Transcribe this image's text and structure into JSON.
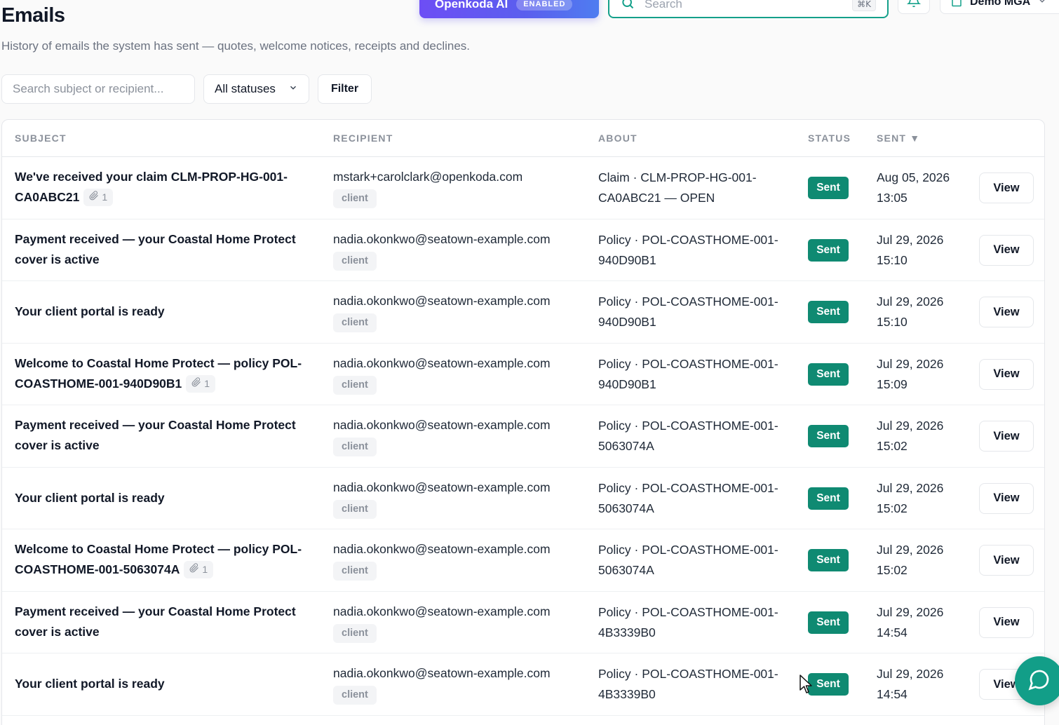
{
  "topbar": {
    "ai_label": "Openkoda AI",
    "ai_badge": "ENABLED",
    "search_placeholder": "Search",
    "search_shortcut": "⌘K",
    "org_name": "Demo MGA"
  },
  "page": {
    "title": "Emails",
    "subtitle": "History of emails the system has sent — quotes, welcome notices, receipts and declines."
  },
  "filters": {
    "search_placeholder": "Search subject or recipient...",
    "status_value": "All statuses",
    "filter_label": "Filter"
  },
  "table": {
    "headers": {
      "subject": "SUBJECT",
      "recipient": "RECIPIENT",
      "about": "ABOUT",
      "status": "STATUS",
      "sent": "SENT ▼"
    },
    "rows": [
      {
        "subject": "We've received your claim CLM-PROP-HG-001-CA0ABC21",
        "attachments": "1",
        "recipient": "mstark+carolclark@openkoda.com",
        "recipient_tag": "client",
        "about": "Claim · CLM-PROP-HG-001-CA0ABC21 — OPEN",
        "status": "Sent",
        "sent": "Aug 05, 2026 13:05",
        "action": "View"
      },
      {
        "subject": "Payment received — your Coastal Home Protect cover is active",
        "attachments": "",
        "recipient": "nadia.okonkwo@seatown-example.com",
        "recipient_tag": "client",
        "about": "Policy · POL-COASTHOME-001-940D90B1",
        "status": "Sent",
        "sent": "Jul 29, 2026 15:10",
        "action": "View"
      },
      {
        "subject": "Your client portal is ready",
        "attachments": "",
        "recipient": "nadia.okonkwo@seatown-example.com",
        "recipient_tag": "client",
        "about": "Policy · POL-COASTHOME-001-940D90B1",
        "status": "Sent",
        "sent": "Jul 29, 2026 15:10",
        "action": "View"
      },
      {
        "subject": "Welcome to Coastal Home Protect — policy POL-COASTHOME-001-940D90B1",
        "attachments": "1",
        "recipient": "nadia.okonkwo@seatown-example.com",
        "recipient_tag": "client",
        "about": "Policy · POL-COASTHOME-001-940D90B1",
        "status": "Sent",
        "sent": "Jul 29, 2026 15:09",
        "action": "View"
      },
      {
        "subject": "Payment received — your Coastal Home Protect cover is active",
        "attachments": "",
        "recipient": "nadia.okonkwo@seatown-example.com",
        "recipient_tag": "client",
        "about": "Policy · POL-COASTHOME-001-5063074A",
        "status": "Sent",
        "sent": "Jul 29, 2026 15:02",
        "action": "View"
      },
      {
        "subject": "Your client portal is ready",
        "attachments": "",
        "recipient": "nadia.okonkwo@seatown-example.com",
        "recipient_tag": "client",
        "about": "Policy · POL-COASTHOME-001-5063074A",
        "status": "Sent",
        "sent": "Jul 29, 2026 15:02",
        "action": "View"
      },
      {
        "subject": "Welcome to Coastal Home Protect — policy POL-COASTHOME-001-5063074A",
        "attachments": "1",
        "recipient": "nadia.okonkwo@seatown-example.com",
        "recipient_tag": "client",
        "about": "Policy · POL-COASTHOME-001-5063074A",
        "status": "Sent",
        "sent": "Jul 29, 2026 15:02",
        "action": "View"
      },
      {
        "subject": "Payment received — your Coastal Home Protect cover is active",
        "attachments": "",
        "recipient": "nadia.okonkwo@seatown-example.com",
        "recipient_tag": "client",
        "about": "Policy · POL-COASTHOME-001-4B3339B0",
        "status": "Sent",
        "sent": "Jul 29, 2026 14:54",
        "action": "View"
      },
      {
        "subject": "Your client portal is ready",
        "attachments": "",
        "recipient": "nadia.okonkwo@seatown-example.com",
        "recipient_tag": "client",
        "about": "Policy · POL-COASTHOME-001-4B3339B0",
        "status": "Sent",
        "sent": "Jul 29, 2026 14:54",
        "action": "View"
      }
    ]
  },
  "icons": {
    "search": "search-icon",
    "bell": "bell-icon",
    "building": "building-icon",
    "chevron": "chevron-down-icon",
    "paperclip": "paperclip-icon",
    "chat": "chat-icon"
  },
  "colors": {
    "accent": "#129e88",
    "sent_badge": "#0f8a72",
    "ai_gradient_start": "#6d4ef5",
    "ai_gradient_end": "#4f7df0"
  }
}
